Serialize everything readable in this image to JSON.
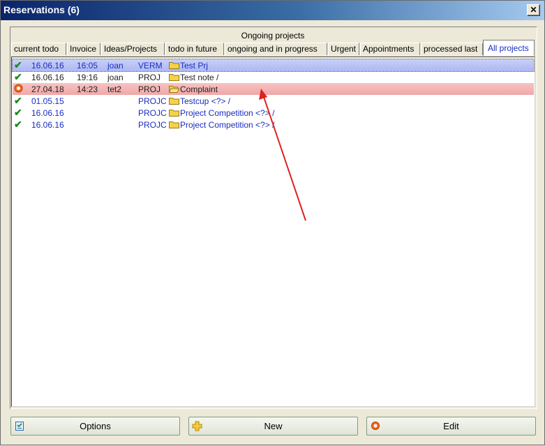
{
  "window": {
    "title": "Reservations (6)",
    "close_glyph": "✕"
  },
  "group": {
    "title": "Ongoing projects"
  },
  "tabs": [
    {
      "label": "current todo"
    },
    {
      "label": "Invoice"
    },
    {
      "label": "Ideas/Projects"
    },
    {
      "label": "todo in future"
    },
    {
      "label": "ongoing and in progress"
    },
    {
      "label": "Urgent"
    },
    {
      "label": "Appointments"
    },
    {
      "label": "processed last"
    },
    {
      "label": "All projects"
    }
  ],
  "rows": [
    {
      "status_icon": "check-icon",
      "date": "16.06.16",
      "time": "16:05",
      "user": "joan",
      "type": "VERM",
      "title": "Test Prj"
    },
    {
      "status_icon": "check-icon",
      "date": "16.06.16",
      "time": "19:16",
      "user": "joan",
      "type": "PROJ",
      "title": "Test note /"
    },
    {
      "status_icon": "alert-circle-icon",
      "date": "27.04.18",
      "time": "14:23",
      "user": "tet2",
      "type": "PROJ",
      "title": "Complaint"
    },
    {
      "status_icon": "check-icon",
      "date": "01.05.15",
      "time": "",
      "user": "",
      "type": "PROJC",
      "title": "Testcup <?> /"
    },
    {
      "status_icon": "check-icon",
      "date": "16.06.16",
      "time": "",
      "user": "",
      "type": "PROJC",
      "title": "Project Competition <?> /"
    },
    {
      "status_icon": "check-icon",
      "date": "16.06.16",
      "time": "",
      "user": "",
      "type": "PROJC",
      "title": "Project Competition <?> /"
    }
  ],
  "buttons": {
    "options": "Options",
    "new": "New",
    "edit": "Edit"
  },
  "colors": {
    "selected_row": "#aeb8f2",
    "alert_row": "#efa8a8",
    "annotation_arrow": "#e02020"
  }
}
